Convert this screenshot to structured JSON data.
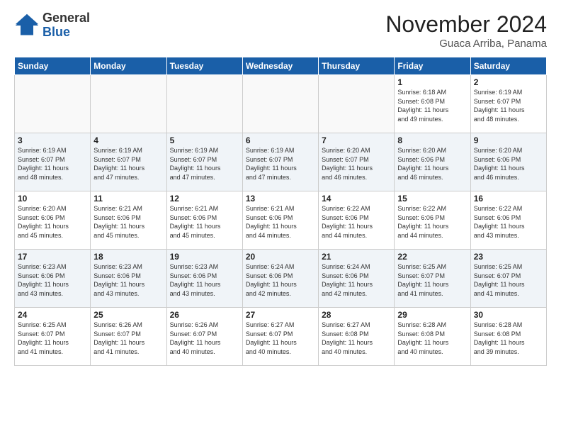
{
  "logo": {
    "general": "General",
    "blue": "Blue"
  },
  "header": {
    "month": "November 2024",
    "location": "Guaca Arriba, Panama"
  },
  "days_of_week": [
    "Sunday",
    "Monday",
    "Tuesday",
    "Wednesday",
    "Thursday",
    "Friday",
    "Saturday"
  ],
  "weeks": [
    [
      {
        "day": "",
        "info": ""
      },
      {
        "day": "",
        "info": ""
      },
      {
        "day": "",
        "info": ""
      },
      {
        "day": "",
        "info": ""
      },
      {
        "day": "",
        "info": ""
      },
      {
        "day": "1",
        "info": "Sunrise: 6:18 AM\nSunset: 6:08 PM\nDaylight: 11 hours\nand 49 minutes."
      },
      {
        "day": "2",
        "info": "Sunrise: 6:19 AM\nSunset: 6:07 PM\nDaylight: 11 hours\nand 48 minutes."
      }
    ],
    [
      {
        "day": "3",
        "info": "Sunrise: 6:19 AM\nSunset: 6:07 PM\nDaylight: 11 hours\nand 48 minutes."
      },
      {
        "day": "4",
        "info": "Sunrise: 6:19 AM\nSunset: 6:07 PM\nDaylight: 11 hours\nand 47 minutes."
      },
      {
        "day": "5",
        "info": "Sunrise: 6:19 AM\nSunset: 6:07 PM\nDaylight: 11 hours\nand 47 minutes."
      },
      {
        "day": "6",
        "info": "Sunrise: 6:19 AM\nSunset: 6:07 PM\nDaylight: 11 hours\nand 47 minutes."
      },
      {
        "day": "7",
        "info": "Sunrise: 6:20 AM\nSunset: 6:07 PM\nDaylight: 11 hours\nand 46 minutes."
      },
      {
        "day": "8",
        "info": "Sunrise: 6:20 AM\nSunset: 6:06 PM\nDaylight: 11 hours\nand 46 minutes."
      },
      {
        "day": "9",
        "info": "Sunrise: 6:20 AM\nSunset: 6:06 PM\nDaylight: 11 hours\nand 46 minutes."
      }
    ],
    [
      {
        "day": "10",
        "info": "Sunrise: 6:20 AM\nSunset: 6:06 PM\nDaylight: 11 hours\nand 45 minutes."
      },
      {
        "day": "11",
        "info": "Sunrise: 6:21 AM\nSunset: 6:06 PM\nDaylight: 11 hours\nand 45 minutes."
      },
      {
        "day": "12",
        "info": "Sunrise: 6:21 AM\nSunset: 6:06 PM\nDaylight: 11 hours\nand 45 minutes."
      },
      {
        "day": "13",
        "info": "Sunrise: 6:21 AM\nSunset: 6:06 PM\nDaylight: 11 hours\nand 44 minutes."
      },
      {
        "day": "14",
        "info": "Sunrise: 6:22 AM\nSunset: 6:06 PM\nDaylight: 11 hours\nand 44 minutes."
      },
      {
        "day": "15",
        "info": "Sunrise: 6:22 AM\nSunset: 6:06 PM\nDaylight: 11 hours\nand 44 minutes."
      },
      {
        "day": "16",
        "info": "Sunrise: 6:22 AM\nSunset: 6:06 PM\nDaylight: 11 hours\nand 43 minutes."
      }
    ],
    [
      {
        "day": "17",
        "info": "Sunrise: 6:23 AM\nSunset: 6:06 PM\nDaylight: 11 hours\nand 43 minutes."
      },
      {
        "day": "18",
        "info": "Sunrise: 6:23 AM\nSunset: 6:06 PM\nDaylight: 11 hours\nand 43 minutes."
      },
      {
        "day": "19",
        "info": "Sunrise: 6:23 AM\nSunset: 6:06 PM\nDaylight: 11 hours\nand 43 minutes."
      },
      {
        "day": "20",
        "info": "Sunrise: 6:24 AM\nSunset: 6:06 PM\nDaylight: 11 hours\nand 42 minutes."
      },
      {
        "day": "21",
        "info": "Sunrise: 6:24 AM\nSunset: 6:06 PM\nDaylight: 11 hours\nand 42 minutes."
      },
      {
        "day": "22",
        "info": "Sunrise: 6:25 AM\nSunset: 6:07 PM\nDaylight: 11 hours\nand 41 minutes."
      },
      {
        "day": "23",
        "info": "Sunrise: 6:25 AM\nSunset: 6:07 PM\nDaylight: 11 hours\nand 41 minutes."
      }
    ],
    [
      {
        "day": "24",
        "info": "Sunrise: 6:25 AM\nSunset: 6:07 PM\nDaylight: 11 hours\nand 41 minutes."
      },
      {
        "day": "25",
        "info": "Sunrise: 6:26 AM\nSunset: 6:07 PM\nDaylight: 11 hours\nand 41 minutes."
      },
      {
        "day": "26",
        "info": "Sunrise: 6:26 AM\nSunset: 6:07 PM\nDaylight: 11 hours\nand 40 minutes."
      },
      {
        "day": "27",
        "info": "Sunrise: 6:27 AM\nSunset: 6:07 PM\nDaylight: 11 hours\nand 40 minutes."
      },
      {
        "day": "28",
        "info": "Sunrise: 6:27 AM\nSunset: 6:08 PM\nDaylight: 11 hours\nand 40 minutes."
      },
      {
        "day": "29",
        "info": "Sunrise: 6:28 AM\nSunset: 6:08 PM\nDaylight: 11 hours\nand 40 minutes."
      },
      {
        "day": "30",
        "info": "Sunrise: 6:28 AM\nSunset: 6:08 PM\nDaylight: 11 hours\nand 39 minutes."
      }
    ]
  ]
}
